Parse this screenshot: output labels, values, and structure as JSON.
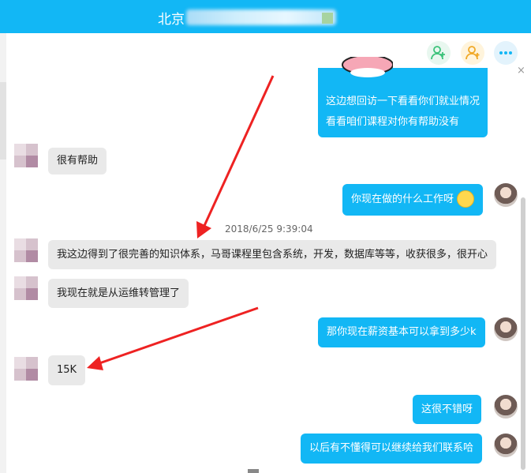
{
  "window": {
    "title": "北京"
  },
  "toolbar": {
    "add_icon": "add-user-icon",
    "group_icon": "group-icon",
    "more_icon": "more-icon",
    "close_glyph": "×"
  },
  "chat": {
    "timestamp": "2018/6/25 9:39:04",
    "messages": [
      {
        "side": "out",
        "lines": [
          "这边想回访一下看看你们就业情况",
          "看看咱们课程对你有帮助没有"
        ]
      },
      {
        "side": "in",
        "text": "很有帮助"
      },
      {
        "side": "out",
        "text": "你现在做的什么工作呀",
        "emoji": "smile-emoji-icon"
      },
      {
        "side": "in",
        "text": "我这边得到了很完善的知识体系，马哥课程里包含系统，开发，数据库等等，收获很多，很开心"
      },
      {
        "side": "in",
        "text": "我现在就是从运维转管理了"
      },
      {
        "side": "out",
        "text": "那你现在薪资基本可以拿到多少k"
      },
      {
        "side": "in",
        "text": "15K"
      },
      {
        "side": "out",
        "text": "这很不错呀"
      },
      {
        "side": "out",
        "text": "以后有不懂得可以继续给我们联系哈"
      }
    ]
  },
  "colors": {
    "accent": "#12b7f5",
    "incoming_bubble": "#e9e9e9",
    "annotation_arrow": "#ee2222"
  }
}
